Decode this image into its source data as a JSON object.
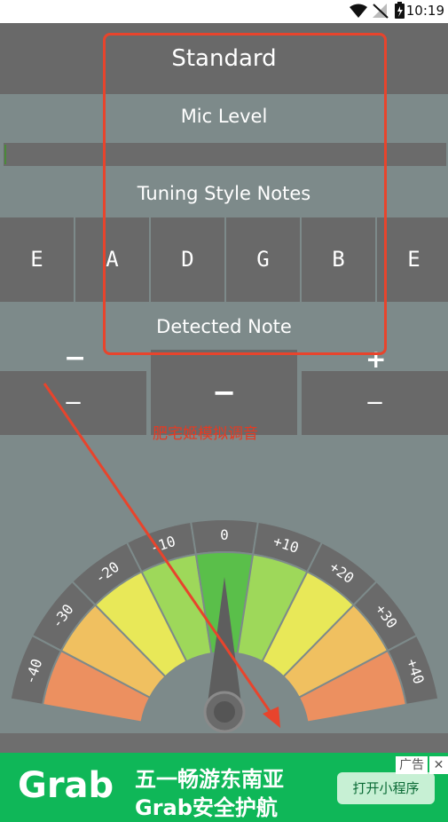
{
  "status": {
    "time": "10:19"
  },
  "tuning": {
    "title": "Standard"
  },
  "mic": {
    "label": "Mic Level"
  },
  "style": {
    "label": "Tuning Style Notes",
    "notes": [
      "E",
      "A",
      "D",
      "G",
      "B",
      "E"
    ]
  },
  "detected": {
    "label": "Detected Note",
    "minus_sign": "−",
    "plus_sign": "+",
    "left_value": "−",
    "center_value": "−",
    "right_value": "−"
  },
  "annotation": {
    "text": "肥宅姬模拟调音"
  },
  "gauge": {
    "ticks": [
      "-40",
      "-30",
      "-20",
      "-10",
      "0",
      "+10",
      "+20",
      "+30",
      "+40"
    ]
  },
  "ad": {
    "brand": "Grab",
    "line1": "五一畅游东南亚",
    "line2": "Grab安全护航",
    "button": "打开小程序",
    "tag": "广告",
    "close": "✕"
  },
  "colors": {
    "bar": "#696969",
    "background": "#7d8a8a",
    "annotation": "#e8442c",
    "ad_green": "#0fb758"
  }
}
